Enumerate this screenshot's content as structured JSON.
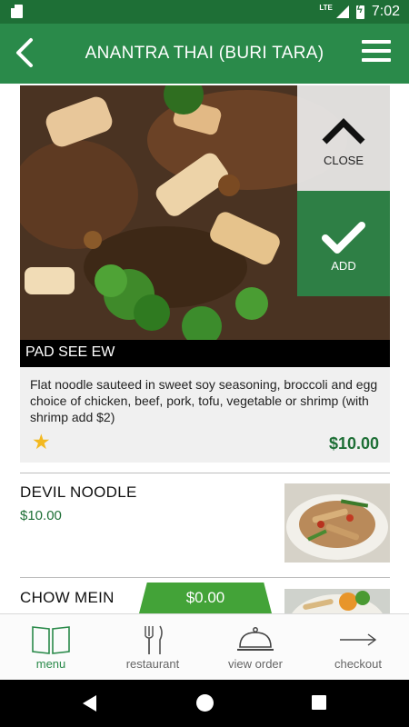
{
  "status_bar": {
    "network": "LTE",
    "time": "7:02"
  },
  "app_bar": {
    "title": "ANANTRA THAI (BURI TARA)"
  },
  "featured_item": {
    "name": "PAD SEE EW",
    "description": "Flat noodle sauteed in sweet soy seasoning, broccoli and egg choice of chicken, beef, pork, tofu, vegetable or shrimp (with shrimp add $2)",
    "price": "$10.00",
    "close_label": "CLOSE",
    "add_label": "ADD"
  },
  "menu_items": [
    {
      "name": "DEVIL NOODLE",
      "price": "$10.00"
    },
    {
      "name": "CHOW MEIN",
      "price": ""
    }
  ],
  "cart": {
    "total": "$0.00"
  },
  "bottom_nav": {
    "items": [
      {
        "label": "menu",
        "icon": "book-icon"
      },
      {
        "label": "restaurant",
        "icon": "fork-knife-icon"
      },
      {
        "label": "view order",
        "icon": "cloche-icon"
      },
      {
        "label": "checkout",
        "icon": "arrow-right-icon"
      }
    ],
    "active": "menu"
  },
  "colors": {
    "primary": "#2a8a4a",
    "status": "#1e6f36",
    "price": "#1e6f36",
    "cart": "#43a338",
    "star": "#f3b920"
  }
}
